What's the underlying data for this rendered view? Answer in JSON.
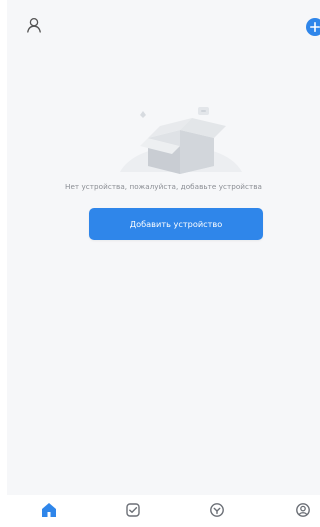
{
  "colors": {
    "accent": "#2f86ea",
    "background": "#f6f7f9",
    "text_muted": "#8a8d93",
    "nav_inactive": "#6b6f76"
  },
  "header": {
    "left_icon": "user-icon",
    "right_icon": "add-icon"
  },
  "empty_state": {
    "message": "Нет устройства, пожалуйста, добавьте устройства",
    "button_label": "Добавить устройство"
  },
  "bottom_nav": {
    "items": [
      {
        "icon": "home-icon",
        "active": true
      },
      {
        "icon": "scenes-icon",
        "active": false
      },
      {
        "icon": "smart-icon",
        "active": false
      },
      {
        "icon": "profile-icon",
        "active": false
      }
    ]
  }
}
